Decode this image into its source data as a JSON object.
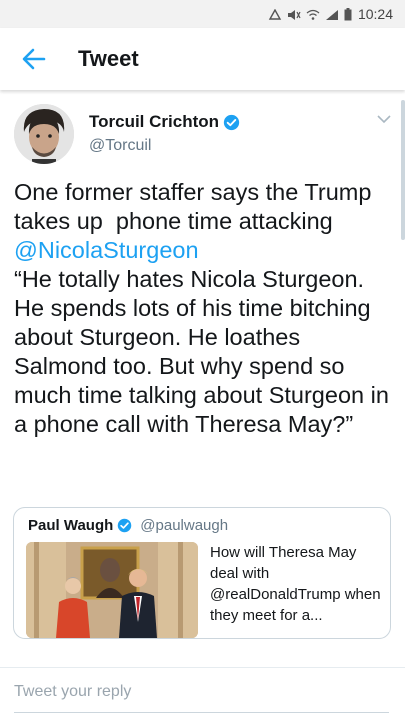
{
  "status_bar": {
    "time": "10:24"
  },
  "app_bar": {
    "title": "Tweet",
    "back_icon": "arrow-left-icon"
  },
  "tweet": {
    "author": {
      "name": "Torcuil Crichton",
      "handle": "@Torcuil",
      "verified": true
    },
    "text_line1": "One former staffer says the Trump takes up  phone time attacking ",
    "mention": "@NicolaSturgeon",
    "text_rest": "\n“He totally hates Nicola Sturgeon. He spends lots of his time bitching about Sturgeon. He loathes Salmond too. But why spend so much time talking about Sturgeon in a phone call with Theresa May?”"
  },
  "quoted_tweet": {
    "name": "Paul Waugh",
    "handle": "@paulwaugh",
    "verified": true,
    "text": "How will Theresa May deal with @realDonaldTrump when they meet for a..."
  },
  "reply": {
    "placeholder": "Tweet your reply"
  },
  "colors": {
    "accent": "#1da1f2",
    "text": "#14171a",
    "muted": "#657786"
  }
}
